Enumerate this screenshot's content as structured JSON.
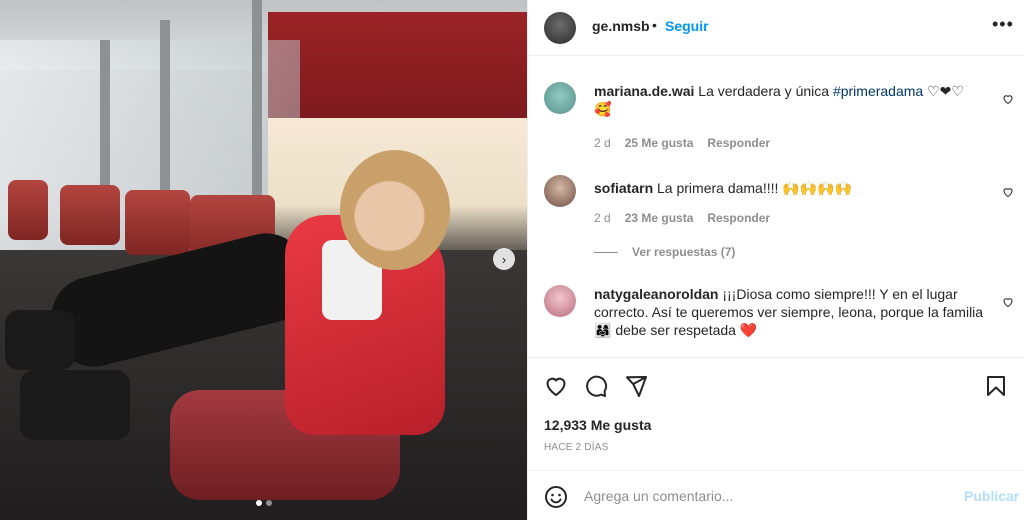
{
  "header": {
    "username": "ge.nmsb",
    "separator": "•",
    "follow_label": "Seguir",
    "more_label": "•••"
  },
  "comments": [
    {
      "username": "mariana.de.wai",
      "text": "La verdadera y única",
      "hashtag": "#primeradama",
      "suffix": "♡❤♡",
      "emoji_line": "🥰",
      "time": "2 d",
      "likes": "25 Me gusta",
      "reply": "Responder"
    },
    {
      "username": "sofiatarn",
      "text": "La primera dama!!!! 🙌🙌🙌🙌",
      "time": "2 d",
      "likes": "23 Me gusta",
      "reply": "Responder"
    },
    {
      "username": "natygaleanoroldan",
      "text": "¡¡¡Diosa como siempre!!! Y en el lugar correcto. Así te queremos ver siempre, leona, porque la familia 👨‍👩‍👧 debe ser respetada ❤️"
    }
  ],
  "replies_label": "Ver respuestas (7)",
  "likes_total": "12,933 Me gusta",
  "post_date": "HACE 2 DÍAS",
  "composer": {
    "placeholder": "Agrega un comentario...",
    "publish_label": "Publicar"
  },
  "carousel": {
    "slide_count": 2,
    "active_slide": 1
  },
  "colors": {
    "accent": "#0095f6",
    "publish_disabled": "#b2dffc",
    "muted": "#8e8e8e",
    "hashtag": "#00376b"
  },
  "icons": [
    "heart-icon",
    "comment-icon",
    "share-icon",
    "bookmark-icon",
    "emoji-icon",
    "chevron-right-icon"
  ]
}
